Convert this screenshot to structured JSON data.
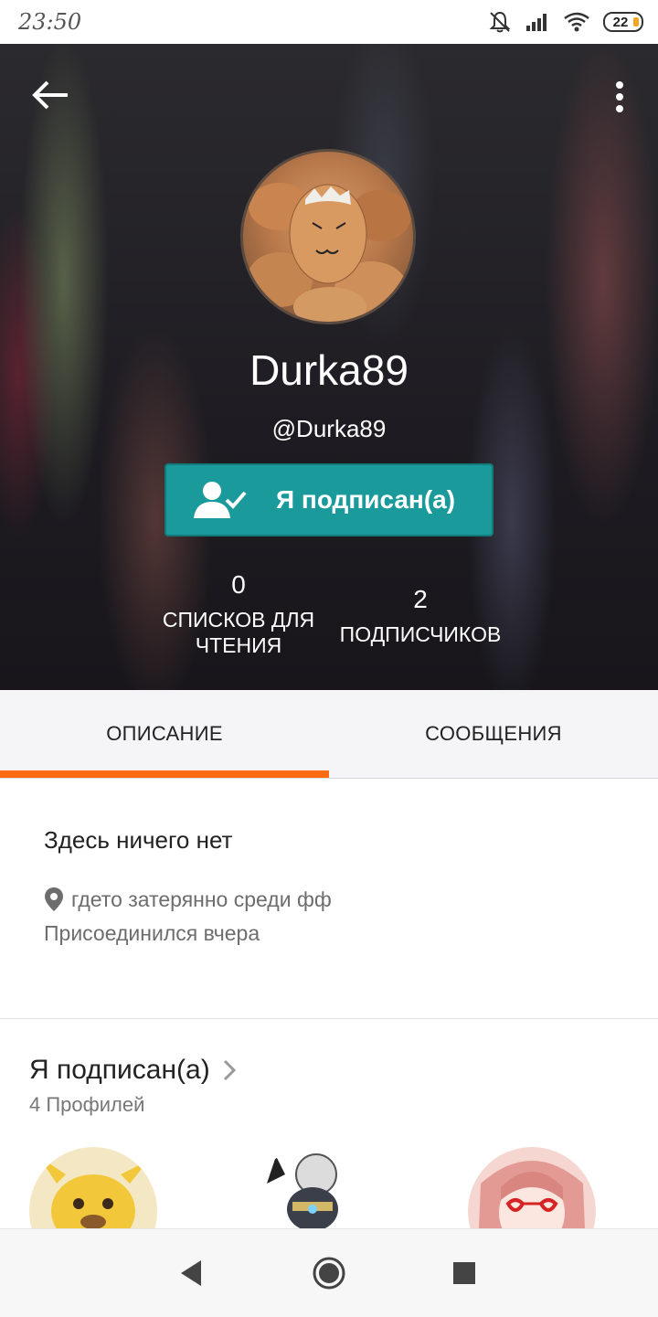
{
  "status_bar": {
    "time": "23:50",
    "battery": "22",
    "icons": [
      "bell-muted-icon",
      "signal-icon",
      "wifi-icon",
      "battery-icon"
    ]
  },
  "header": {
    "back_icon": "arrow-left-icon",
    "menu_icon": "more-vert-icon",
    "display_name": "Durka89",
    "handle": "@Durka89",
    "follow_button_label": "Я подписан(а)",
    "follow_button_color": "#1a9a9a",
    "stats": {
      "reading_lists": {
        "value": "0",
        "label": "СПИСКОВ ДЛЯ ЧТЕНИЯ"
      },
      "followers": {
        "value": "2",
        "label": "ПОДПИСЧИКОВ"
      }
    }
  },
  "tabs": [
    {
      "label": "ОПИСАНИЕ",
      "active": true
    },
    {
      "label": "СООБЩЕНИЯ",
      "active": false
    }
  ],
  "tab_accent_color": "#ff6a13",
  "about": {
    "description": "Здесь ничего нет",
    "location": "гдето затерянно среди фф",
    "joined": "Присоединился вчера"
  },
  "following": {
    "title": "Я подписан(а)",
    "count": "4 Профилей",
    "avatars": [
      "pikachu-avatar",
      "helmet-character-avatar",
      "red-hair-glasses-avatar"
    ]
  },
  "nav": {
    "buttons": [
      "back-triangle-icon",
      "home-circle-icon",
      "recents-square-icon"
    ]
  }
}
